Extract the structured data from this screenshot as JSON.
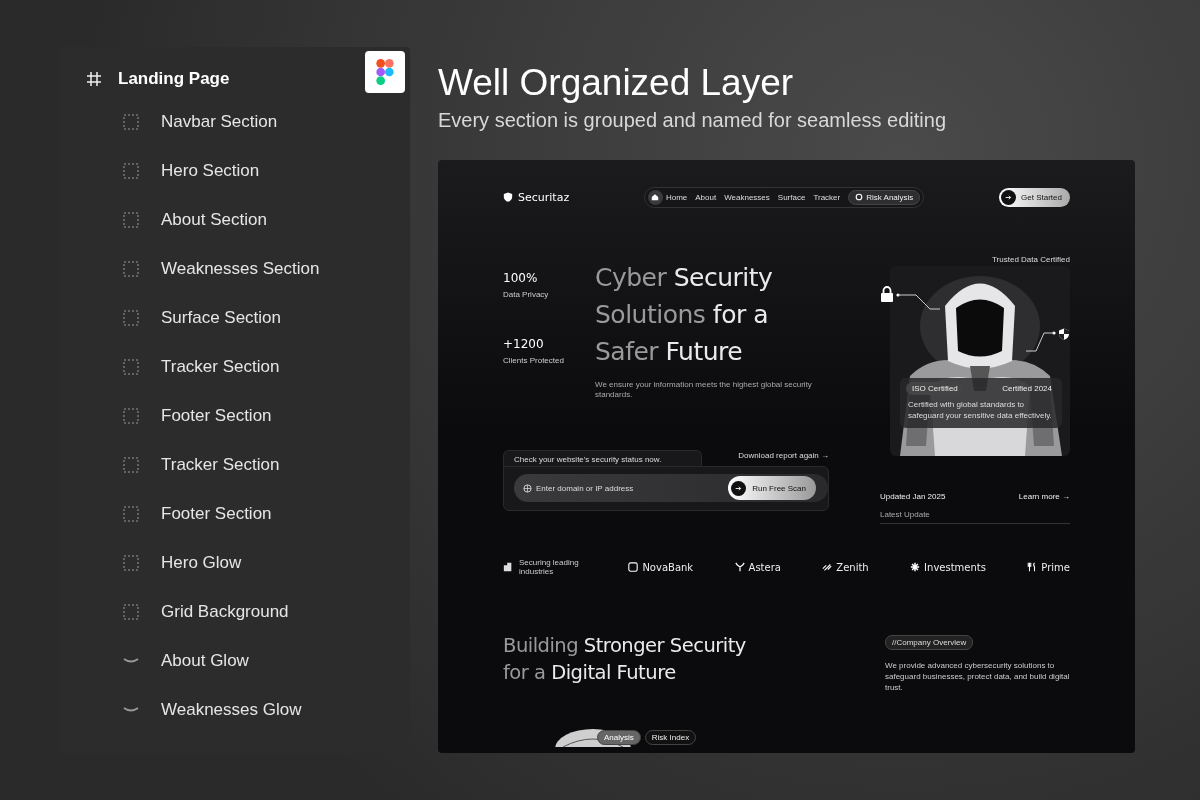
{
  "layers": {
    "title": "Landing Page",
    "kind": "frame",
    "children": [
      {
        "label": "Navbar Section",
        "kind": "section"
      },
      {
        "label": "Hero Section",
        "kind": "section"
      },
      {
        "label": "About Section",
        "kind": "section"
      },
      {
        "label": "Weaknesses Section",
        "kind": "section"
      },
      {
        "label": "Surface Section",
        "kind": "section"
      },
      {
        "label": "Tracker Section",
        "kind": "section"
      },
      {
        "label": "Footer Section",
        "kind": "section"
      },
      {
        "label": "Tracker Section",
        "kind": "section"
      },
      {
        "label": "Footer Section",
        "kind": "section"
      },
      {
        "label": "Hero Glow",
        "kind": "section"
      },
      {
        "label": "Grid Background",
        "kind": "section"
      },
      {
        "label": "About Glow",
        "kind": "glow"
      },
      {
        "label": "Weaknesses Glow",
        "kind": "glow"
      }
    ]
  },
  "heading": {
    "title": "Well Organized Layer",
    "subtitle": "Every section is grouped and named for seamless editing"
  },
  "preview": {
    "brand": "Securitaz",
    "nav_links": [
      "Home",
      "About",
      "Weaknesses",
      "Surface",
      "Tracker"
    ],
    "nav_button": "Risk Analysis",
    "cta": "Get Started",
    "stats": [
      {
        "value": "100%",
        "label": "Data Privacy"
      },
      {
        "value": "+1200",
        "label": "Clients Protected"
      }
    ],
    "hero_title": [
      [
        {
          "text": "Cyber",
          "dim": true
        },
        {
          "text": "Security",
          "dim": false
        }
      ],
      [
        {
          "text": "Solutions",
          "dim": true
        },
        {
          "text": "for a",
          "dim": false
        }
      ],
      [
        {
          "text": "Safer",
          "dim": true
        },
        {
          "text": "Future",
          "dim": false
        }
      ]
    ],
    "hero_subtitle": "We ensure your information meets the highest global security standards.",
    "scan": {
      "prompt": "Check your website's security status now.",
      "download": "Download report again →",
      "placeholder": "Enter domain or IP address",
      "button": "Run Free Scan"
    },
    "certificate": {
      "caption": "Trusted Data Certified",
      "badge": "ISO Certified",
      "year": "Certified 2024",
      "text": "Certified with global standards to safeguard your sensitive data effectively."
    },
    "update": {
      "date": "Updated Jan 2025",
      "link": "Learn more →",
      "label": "Latest Update"
    },
    "partners_label": "Securing leading industries",
    "partners": [
      "NovaBank",
      "Astera",
      "Zenith",
      "Investments",
      "Prime"
    ],
    "about_title": [
      [
        {
          "text": "Building",
          "dim": true
        },
        {
          "text": "Stronger Security",
          "dim": false
        }
      ],
      [
        {
          "text": "for a",
          "dim": true
        },
        {
          "text": "Digital Future",
          "dim": false
        }
      ]
    ],
    "about_tag": "//Company Overview",
    "about_text": "We provide advanced cybersecurity solutions to safeguard businesses, protect data, and build digital trust.",
    "tabs": [
      {
        "label": "Analysis",
        "selected": true
      },
      {
        "label": "Risk Index",
        "selected": false
      }
    ]
  }
}
